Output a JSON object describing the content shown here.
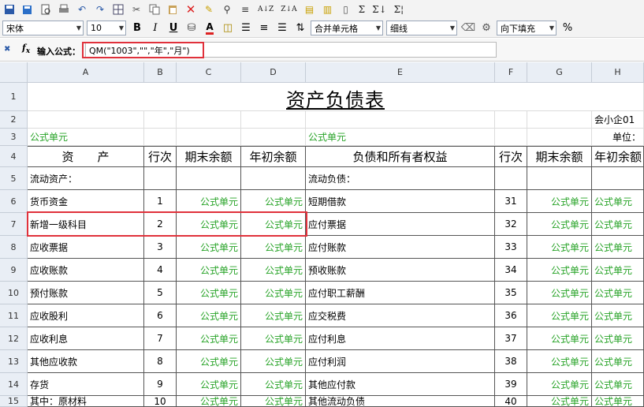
{
  "toolbar": {
    "bold": "B",
    "italic": "I",
    "underline": "U",
    "text_color": "A",
    "sum1": "Σ",
    "sum2": "Σ↓",
    "sum3": "Σ¦",
    "sort_asc": "A↓Z",
    "sort_desc": "Z↓A"
  },
  "format": {
    "font": "宋体",
    "size": "10",
    "merge": "合并单元格",
    "border": "细线",
    "fill": "向下填充",
    "extra": "%"
  },
  "formula": {
    "label": "输入公式：",
    "value": "QM(\"1003\",\"\",\"年\",\"月\")"
  },
  "columns": [
    "A",
    "B",
    "C",
    "D",
    "E",
    "F",
    "G",
    "H"
  ],
  "rows": [
    "1",
    "2",
    "3",
    "4",
    "5",
    "6",
    "7",
    "8",
    "9",
    "10",
    "11",
    "12",
    "13",
    "14",
    "15"
  ],
  "sheet": {
    "title": "资产负债表",
    "form_code": "会小企01",
    "unit": "单位：",
    "formula_unit": "公式单元",
    "headers": {
      "asset": "资　　产",
      "line": "行次",
      "end_balance": "期末余额",
      "begin_balance": "年初余额",
      "liability": "负债和所有者权益",
      "line2": "行次",
      "end_balance2": "期末余额",
      "begin_balance2": "年初余额"
    },
    "section_left": "流动资产：",
    "section_right": "流动负债：",
    "body": [
      {
        "left": "货币资金",
        "n1": "1",
        "right": "短期借款",
        "n2": "31"
      },
      {
        "left": "新增一级科目",
        "n1": "2",
        "right": "应付票据",
        "n2": "32"
      },
      {
        "left": "应收票据",
        "n1": "3",
        "right": "应付账款",
        "n2": "33"
      },
      {
        "left": "应收账款",
        "n1": "4",
        "right": "预收账款",
        "n2": "34"
      },
      {
        "left": "预付账款",
        "n1": "5",
        "right": "应付职工薪酬",
        "n2": "35"
      },
      {
        "left": "应收股利",
        "n1": "6",
        "right": "应交税费",
        "n2": "36"
      },
      {
        "left": "应收利息",
        "n1": "7",
        "right": "应付利息",
        "n2": "37"
      },
      {
        "left": "其他应收款",
        "n1": "8",
        "right": "应付利润",
        "n2": "38"
      },
      {
        "left": "存货",
        "n1": "9",
        "right": "其他应付款",
        "n2": "39"
      },
      {
        "left": "其中：原材料",
        "n1": "10",
        "right": "其他流动负债",
        "n2": "40"
      }
    ]
  }
}
